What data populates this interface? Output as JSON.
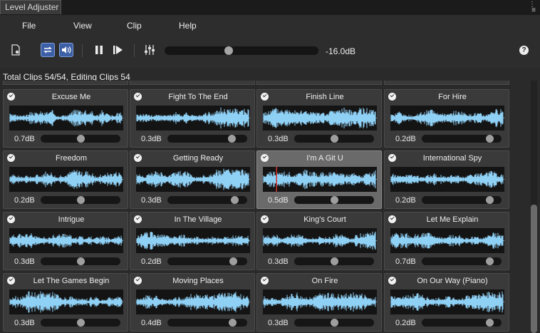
{
  "window": {
    "tab_title": "Level Adjuster"
  },
  "menu": [
    {
      "label": "File"
    },
    {
      "label": "View"
    },
    {
      "label": "Clip"
    },
    {
      "label": "Help"
    }
  ],
  "toolbar": {
    "master_gain_label": "-16.0dB",
    "master_gain_fraction": 0.41,
    "help_label": "?",
    "icons": [
      "document-settings-icon",
      "loop-icon",
      "speaker-icon",
      "pause-icon",
      "play-next-icon",
      "mixer-sliders-icon"
    ]
  },
  "status": "Total Clips 54/54, Editing Clips 54",
  "colors": {
    "waveform": "#8fd0f5",
    "playhead": "#d0322a",
    "selected_card": "#6a6a6a"
  },
  "clips": [
    {
      "name": "Excuse Me",
      "gain": "0.7dB",
      "level": 0.5,
      "checked": true
    },
    {
      "name": "Fight To The End",
      "gain": "0.3dB",
      "level": 0.84,
      "checked": true
    },
    {
      "name": "Finish Line",
      "gain": "0.3dB",
      "level": 0.5,
      "checked": true
    },
    {
      "name": "For Hire",
      "gain": "0.2dB",
      "level": 0.89,
      "checked": true
    },
    {
      "name": "Freedom",
      "gain": "0.2dB",
      "level": 0.5,
      "checked": true
    },
    {
      "name": "Getting Ready",
      "gain": "0.3dB",
      "level": 0.88,
      "checked": true
    },
    {
      "name": "I'm A Git U",
      "gain": "0.5dB",
      "level": 0.5,
      "checked": true,
      "selected": true,
      "playhead": 0.12
    },
    {
      "name": "International Spy",
      "gain": "0.2dB",
      "level": 0.89,
      "checked": true
    },
    {
      "name": "Intrigue",
      "gain": "0.3dB",
      "level": 0.5,
      "checked": true
    },
    {
      "name": "In The Village",
      "gain": "0.2dB",
      "level": 0.86,
      "checked": true
    },
    {
      "name": "King's Court",
      "gain": "0.3dB",
      "level": 0.5,
      "checked": true
    },
    {
      "name": "Let Me Explain",
      "gain": "0.7dB",
      "level": 0.89,
      "checked": true
    },
    {
      "name": "Let The Games Begin",
      "gain": "0.3dB",
      "level": 0.5,
      "checked": true
    },
    {
      "name": "Moving Places",
      "gain": "0.4dB",
      "level": 0.85,
      "checked": true
    },
    {
      "name": "On Fire",
      "gain": "0.3dB",
      "level": 0.5,
      "checked": true
    },
    {
      "name": "On Our Way (Piano)",
      "gain": "0.2dB",
      "level": 0.89,
      "checked": true
    }
  ]
}
